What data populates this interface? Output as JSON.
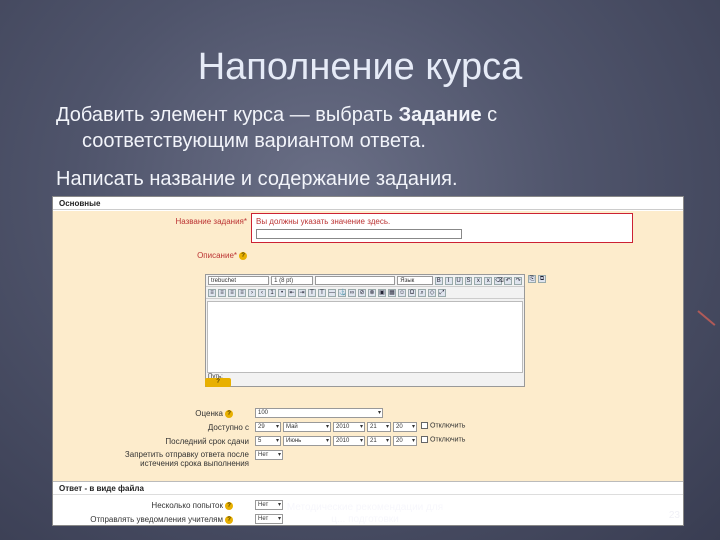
{
  "slide": {
    "title": "Наполнение курса",
    "bullet1_pre": "Добавить элемент курса — выбрать ",
    "bullet1_bold": "Задание",
    "bullet1_post": " с",
    "bullet1_line2": "соответствующим вариантом ответа.",
    "bullet2": "Написать название и содержание задания.",
    "footer": "Методические рекомендации для",
    "footer2": "ц... подготовки",
    "page_number": "23"
  },
  "form": {
    "section_main": "Основные",
    "name_label": "Название задания*",
    "name_error": "Вы должны указать значение здесь.",
    "description_label": "Описание*",
    "editor": {
      "font": "trebuchet",
      "size": "1 (8 pt)",
      "lang": "Язык",
      "path": "Путь:",
      "help": "?"
    },
    "grade_label": "Оценка",
    "grade_value": "100",
    "available_label": "Доступно с",
    "available_day": "29",
    "available_month": "Май",
    "available_year": "2010",
    "available_hour": "21",
    "available_min": "20",
    "disable_label": "Отключить",
    "due_label": "Последний срок сдачи",
    "due_day": "5",
    "due_month": "Июнь",
    "due_year": "2010",
    "due_hour": "21",
    "due_min": "20",
    "prevent_label_1": "Запретить отправку ответа после",
    "prevent_label_2": "истечения срока выполнения",
    "prevent_value": "Нет",
    "section_file": "Ответ - в виде файла",
    "attempts_label": "Несколько попыток",
    "attempts_value": "Нет",
    "notify_label": "Отправлять уведомления учителям",
    "notify_value": "Нет"
  }
}
